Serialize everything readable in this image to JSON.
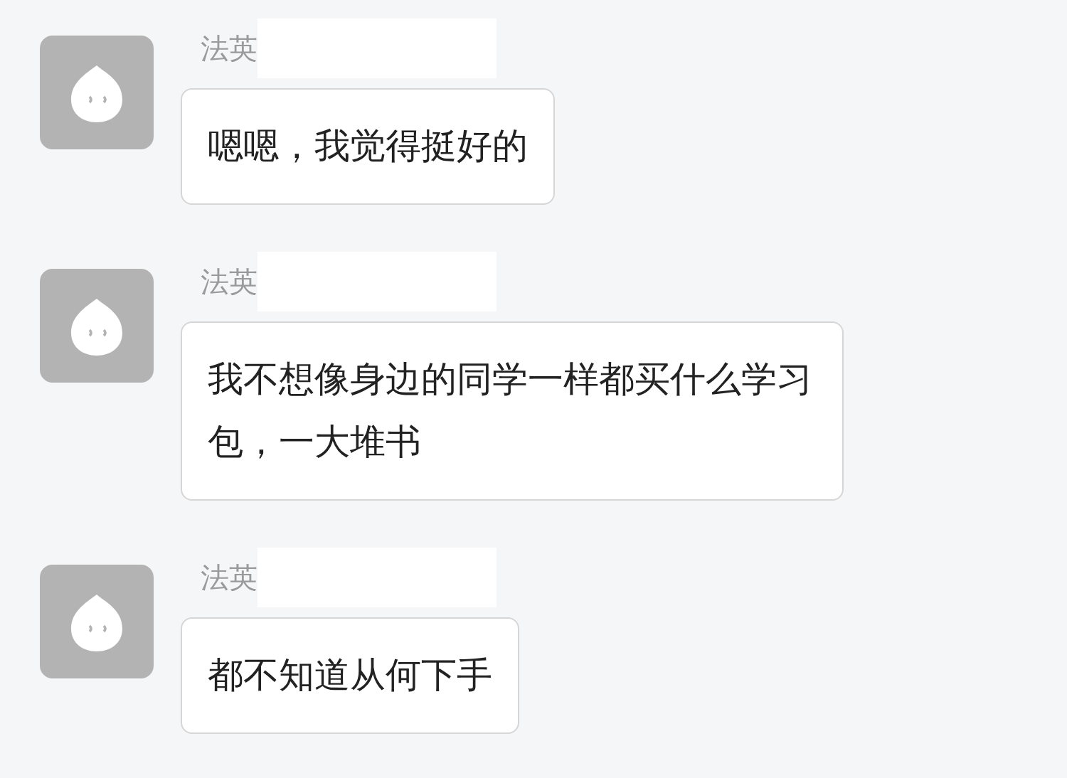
{
  "messages": [
    {
      "sender": "法英",
      "name_redacted": true,
      "text": "嗯嗯，我觉得挺好的"
    },
    {
      "sender": "法英",
      "name_redacted": true,
      "text": "我不想像身边的同学一样都买什么学习包，一大堆书"
    },
    {
      "sender": "法英",
      "name_redacted": true,
      "text": "都不知道从何下手"
    }
  ]
}
